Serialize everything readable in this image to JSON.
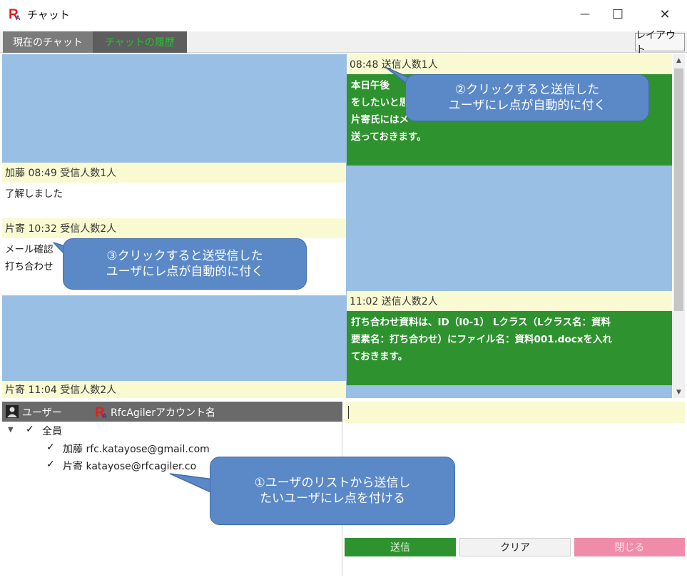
{
  "window": {
    "title": "チャット",
    "minimize_glyph": "—",
    "maximize_glyph": "☐",
    "close_glyph": "✕"
  },
  "tabs": [
    {
      "label": "現在のチャット"
    },
    {
      "label": "チャットの履歴"
    }
  ],
  "layout_button": "レイアウト",
  "chat": {
    "sent1": {
      "header": "08:48  送信人数1人",
      "lines": [
        "本日午後",
        "をしたいと思",
        "片寄氏にはメ",
        "送っておきます。"
      ]
    },
    "recv1": {
      "header": "加藤  08:49  受信人数1人",
      "lines": [
        "了解しました"
      ]
    },
    "recv2": {
      "header": "片寄  10:32  受信人数2人",
      "lines": [
        "メール確認",
        "打ち合わせ"
      ]
    },
    "sent2": {
      "header": "11:02  送信人数2人",
      "lines": [
        "打ち合わせ資料は、ID（I0-1）  Lクラス（Lクラス名：資料",
        "要素名：打ち合わせ）にファイル名：資料001.docxを入れ",
        "ておきます。"
      ]
    },
    "recv3": {
      "header": "片寄  11:04  受信人数2人"
    }
  },
  "users": {
    "col_user": "ユーザー",
    "col_account": "RfcAgilerアカウント名",
    "all_label": "全員",
    "items": [
      {
        "name": "加藤",
        "account": "rfc.katayose@gmail.com"
      },
      {
        "name": "片寄",
        "account": "katayose@rfcagiler.co"
      }
    ]
  },
  "buttons": {
    "send": "送信",
    "clear": "クリア",
    "close": "閉じる"
  },
  "callouts": {
    "c1": [
      "①ユーザのリストから送信し",
      "たいユーザにレ点を付ける"
    ],
    "c2": [
      "②クリックすると送信した",
      "ユーザにレ点が自動的に付く"
    ],
    "c3": [
      "③クリックすると送受信した",
      "ユーザにレ点が自動的に付く"
    ]
  },
  "colors": {
    "chat_bg": "#99bfe5",
    "header_bg": "#fafad2",
    "sent_bg": "#2e922e",
    "callout_bg": "#5b89c7",
    "send_button": "#2e922e",
    "close_button": "#f08caa"
  },
  "checkbox_glyph": "✓",
  "expand_glyph": "▼",
  "scroll_up_glyph": "▲",
  "scroll_down_glyph": "▼"
}
